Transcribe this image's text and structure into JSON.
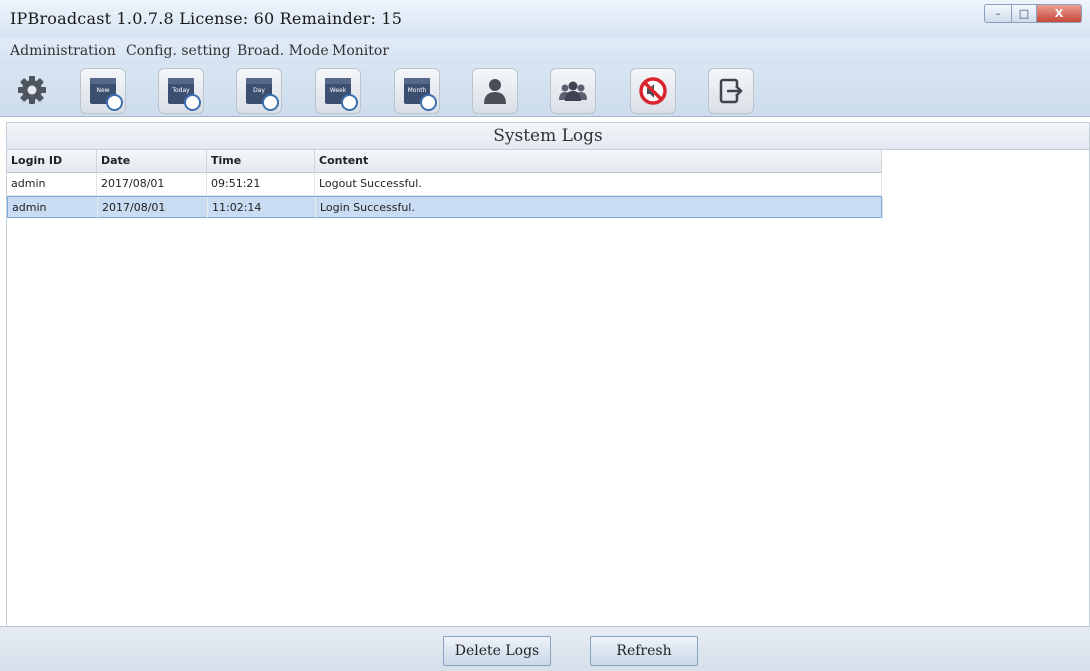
{
  "window": {
    "title": "IPBroadcast 1.0.7.8 License: 60 Remainder: 15",
    "controls": {
      "minimize": "–",
      "maximize": "□",
      "close": "X"
    }
  },
  "menu": {
    "items": [
      {
        "label": "Administration"
      },
      {
        "label": "Config. setting"
      },
      {
        "label": "Broad. Mode"
      },
      {
        "label": "Monitor"
      }
    ]
  },
  "toolbar": {
    "buttons": [
      {
        "icon": "gear-icon"
      },
      {
        "icon": "calendar-new-icon",
        "label": "New"
      },
      {
        "icon": "calendar-today-icon",
        "label": "Today"
      },
      {
        "icon": "calendar-day-icon",
        "label": "Day"
      },
      {
        "icon": "calendar-week-icon",
        "label": "Week"
      },
      {
        "icon": "calendar-month-icon",
        "label": "Month"
      },
      {
        "icon": "user-icon"
      },
      {
        "icon": "users-group-icon"
      },
      {
        "icon": "mute-icon"
      },
      {
        "icon": "logout-icon"
      }
    ]
  },
  "panel": {
    "title": "System Logs",
    "columns": [
      "Login ID",
      "Date",
      "Time",
      "Content"
    ],
    "rows": [
      {
        "login_id": "admin",
        "date": "2017/08/01",
        "time": "09:51:21",
        "content": "Logout Successful.",
        "selected": false
      },
      {
        "login_id": "admin",
        "date": "2017/08/01",
        "time": "11:02:14",
        "content": "Login Successful.",
        "selected": true
      }
    ]
  },
  "footer": {
    "delete_label": "Delete Logs",
    "refresh_label": "Refresh"
  },
  "colors": {
    "title_bar": "#d6e4f3",
    "selected_row": "#c8dcf3",
    "mute_red": "#d9262e",
    "calendar_dark": "#3d4f70"
  }
}
